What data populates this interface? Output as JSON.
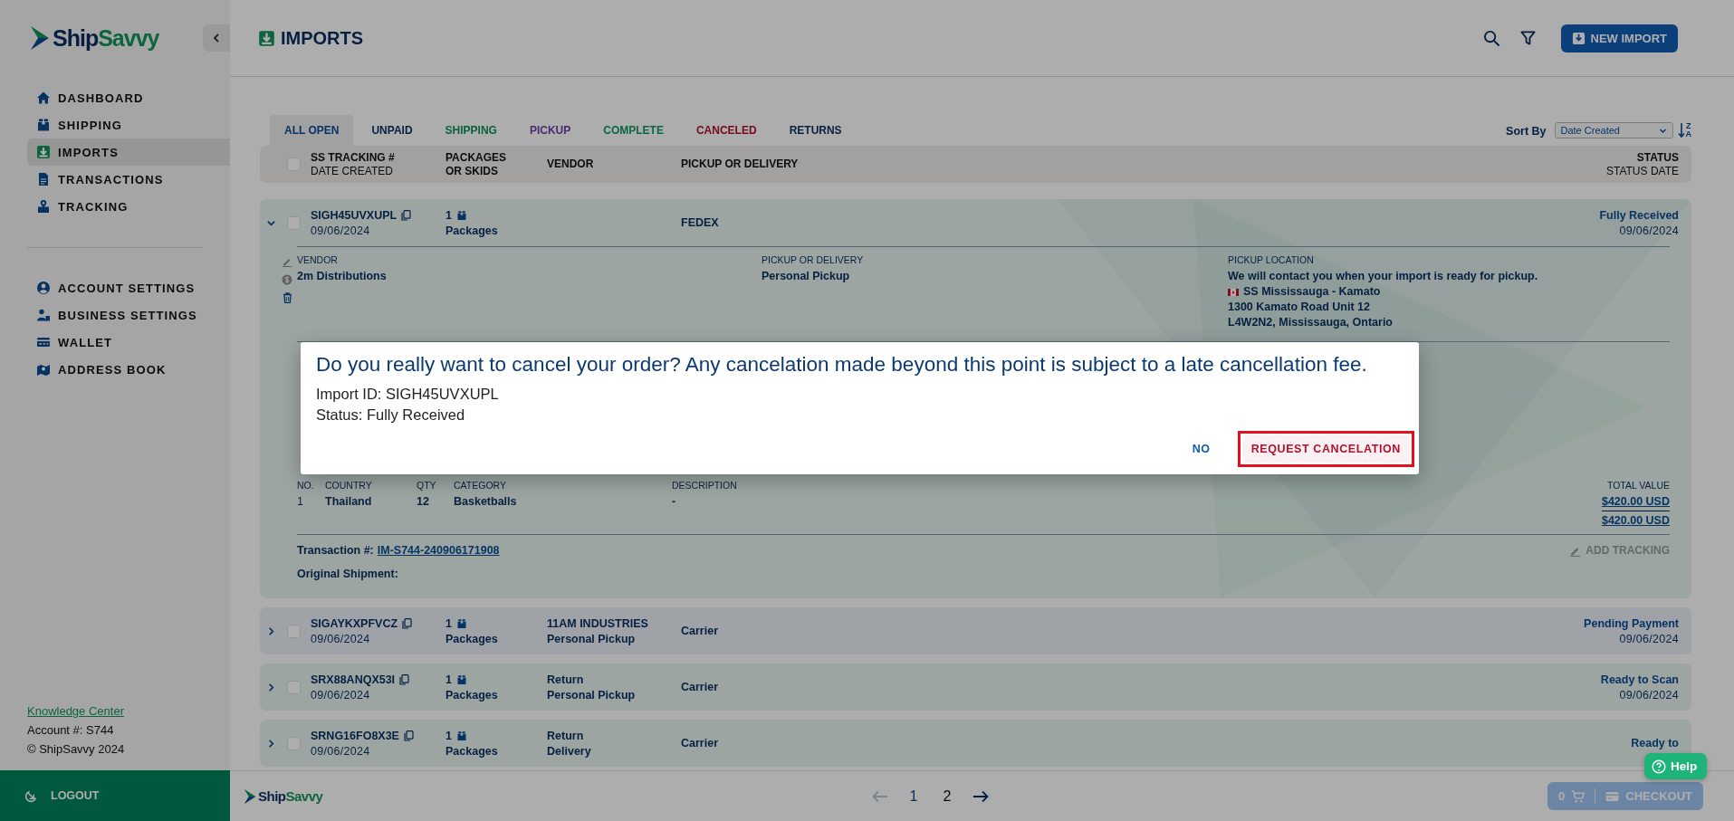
{
  "sidebar": {
    "logo": {
      "part1": "Ship",
      "part2": "Savvy"
    },
    "nav": [
      {
        "label": "DASHBOARD",
        "selected": false
      },
      {
        "label": "SHIPPING",
        "selected": false
      },
      {
        "label": "IMPORTS",
        "selected": true
      },
      {
        "label": "TRANSACTIONS",
        "selected": false
      },
      {
        "label": "TRACKING",
        "selected": false
      }
    ],
    "settings_nav": [
      {
        "label": "ACCOUNT SETTINGS",
        "selected": false
      },
      {
        "label": "BUSINESS SETTINGS",
        "selected": false
      },
      {
        "label": "WALLET",
        "selected": false
      },
      {
        "label": "ADDRESS BOOK",
        "selected": false
      }
    ],
    "knowledge_link": "Knowledge Center",
    "account": "Account #: S744",
    "copyright": "© ShipSavvy 2024",
    "logout": "LOGOUT"
  },
  "header": {
    "title": "IMPORTS",
    "new_button": "NEW IMPORT"
  },
  "tabs": [
    {
      "label": "ALL OPEN",
      "selected": true,
      "kind": "all"
    },
    {
      "label": "UNPAID",
      "selected": false,
      "kind": "unpaid"
    },
    {
      "label": "SHIPPING",
      "selected": false,
      "kind": "shipping"
    },
    {
      "label": "PICKUP",
      "selected": false,
      "kind": "pickup"
    },
    {
      "label": "COMPLETE",
      "selected": false,
      "kind": "complete"
    },
    {
      "label": "CANCELED",
      "selected": false,
      "kind": "canceled"
    },
    {
      "label": "RETURNS",
      "selected": false,
      "kind": "returns"
    }
  ],
  "sort": {
    "label": "Sort By",
    "value": "Date Created",
    "order_top": "Z",
    "order_bottom": "A"
  },
  "table": {
    "select_all_checked": false,
    "columns": [
      {
        "title": "SS TRACKING #",
        "subtitle": "DATE CREATED"
      },
      {
        "title": "PACKAGES OR SKIDS"
      },
      {
        "title": "VENDOR"
      },
      {
        "title": "PICKUP OR DELIVERY"
      },
      {
        "title": "STATUS",
        "subtitle": "STATUS DATE"
      }
    ],
    "rows": [
      {
        "tracking": "SIGH45UVXUPL",
        "date": "09/06/2024",
        "count": "1",
        "unit": "Packages",
        "delivery": "FEDEX",
        "status": "Fully Received",
        "status_date": "09/06/2024",
        "expanded": true,
        "checked": false,
        "kind": "received",
        "details": {
          "vendor_label": "VENDOR",
          "vendor": "2m Distributions",
          "delivery_label": "PICKUP OR DELIVERY",
          "delivery": "Personal Pickup",
          "location_label": "PICKUP LOCATION",
          "location_note": "We will contact you when your import is ready for pickup.",
          "location_name": "SS Mississauga - Kamato",
          "location_lines": [
            "1300 Kamato Road Unit 12",
            "L4W2N2, Mississauga, Ontario"
          ],
          "items": {
            "columns": [
              "NO.",
              "COUNTRY",
              "QTY",
              "CATEGORY",
              "DESCRIPTION"
            ],
            "total_label": "TOTAL VALUE",
            "rows": [
              [
                "1",
                "Thailand",
                "12",
                "Basketballs",
                "-"
              ]
            ],
            "line_total": "$420.00 USD",
            "grand_total": "$420.00 USD"
          },
          "transaction_label": "Transaction #:",
          "transaction": "IM-S744-240906171908",
          "add_tracking": {
            "label": "ADD TRACKING",
            "disabled": true
          },
          "original_shipment": "Original Shipment:"
        }
      },
      {
        "tracking": "SIGAYKXPFVCZ",
        "date": "09/06/2024",
        "count": "1",
        "unit": "Packages",
        "vendor": "11AM INDUSTRIES",
        "method": "Personal Pickup",
        "delivery": "Carrier",
        "status": "Pending Payment",
        "status_date": "09/06/2024",
        "expanded": false,
        "checked": false,
        "kind": "pending"
      },
      {
        "tracking": "SRX88ANQX53I",
        "date": "09/06/2024",
        "count": "1",
        "unit": "Packages",
        "vendor": "Return",
        "method": "Personal Pickup",
        "delivery": "Carrier",
        "status": "Ready to Scan",
        "status_date": "09/06/2024",
        "expanded": false,
        "checked": false,
        "kind": "ready"
      },
      {
        "tracking": "SRNG16FO8X3E",
        "date": "09/06/2024",
        "count": "1",
        "unit": "Packages",
        "vendor": "Return",
        "method": "Delivery",
        "delivery": "Carrier",
        "status": "Ready to",
        "expanded": false,
        "checked": false,
        "kind": "ready"
      }
    ]
  },
  "footer": {
    "logo": {
      "part1": "Ship",
      "part2": "Savvy"
    },
    "prev_disabled": true,
    "pages": [
      {
        "label": "1",
        "selected": true
      },
      {
        "label": "2",
        "selected": false
      }
    ],
    "cart_count": "0",
    "checkout": "CHECKOUT",
    "checkout_disabled": true
  },
  "help": {
    "label": "Help"
  },
  "modal": {
    "message": "Do you really want to cancel your order? Any cancelation made beyond this point is subject to a late cancellation fee.",
    "import_id": "Import ID: SIGH45UVXUPL",
    "status": "Status: Fully Received",
    "buttons": [
      {
        "label": "NO",
        "kind": "plain",
        "highlighted": false
      },
      {
        "label": "REQUEST CANCELATION",
        "kind": "danger",
        "highlighted": true
      }
    ]
  }
}
